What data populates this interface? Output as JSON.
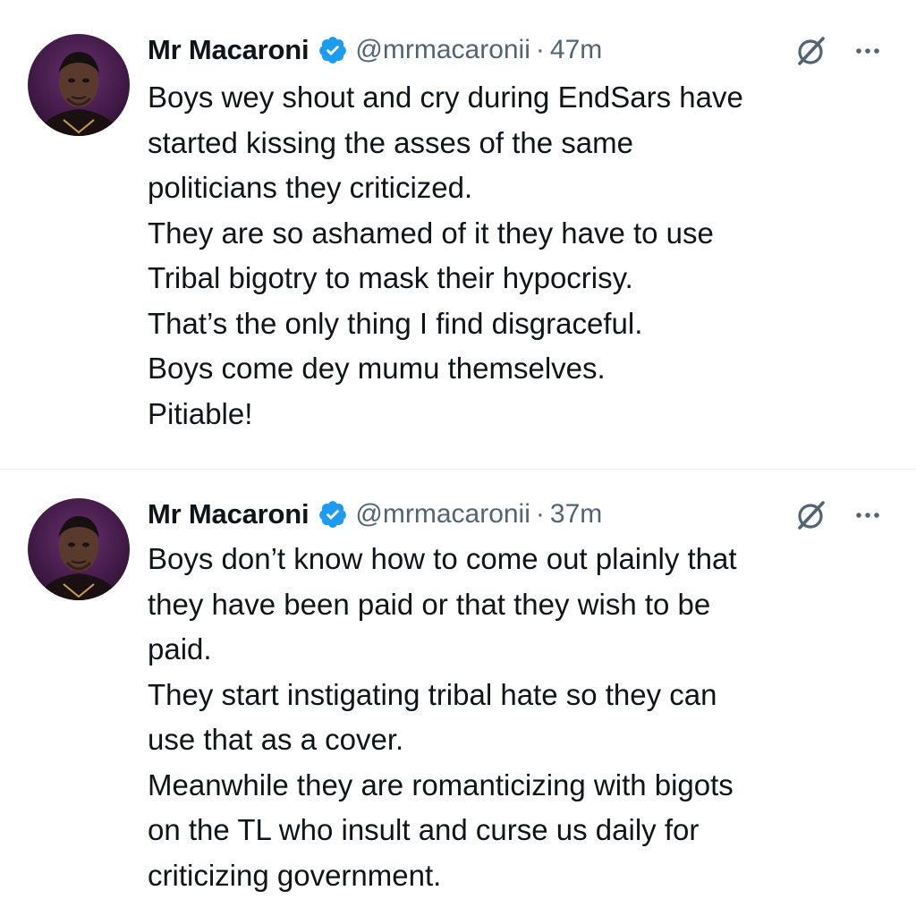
{
  "tweets": [
    {
      "author_name": "Mr Macaroni",
      "handle": "@mrmacaronii",
      "separator": "·",
      "time": "47m",
      "verified_icon": "verified-badge-icon",
      "lines": [
        "Boys wey shout and cry during EndSars have",
        "started kissing the asses of the same",
        "politicians they criticized.",
        "They are so ashamed of it they have to use",
        "Tribal bigotry to mask their hypocrisy.",
        "That’s the only thing I find disgraceful.",
        "Boys come dey mumu themselves.",
        "Pitiable!"
      ]
    },
    {
      "author_name": "Mr Macaroni",
      "handle": "@mrmacaronii",
      "separator": "·",
      "time": "37m",
      "verified_icon": "verified-badge-icon",
      "lines": [
        "Boys don’t know how to come out plainly that",
        "they have been paid or that they wish to be",
        "paid.",
        "They start instigating tribal hate so they can",
        "use that as a cover.",
        "Meanwhile they are romanticizing with bigots",
        "on the TL who insult and curse us daily for",
        "criticizing government."
      ]
    }
  ],
  "colors": {
    "verified": "#1d9bf0",
    "secondary_text": "#536471",
    "primary_text": "#0f1419",
    "divider": "#e6e9ec"
  }
}
